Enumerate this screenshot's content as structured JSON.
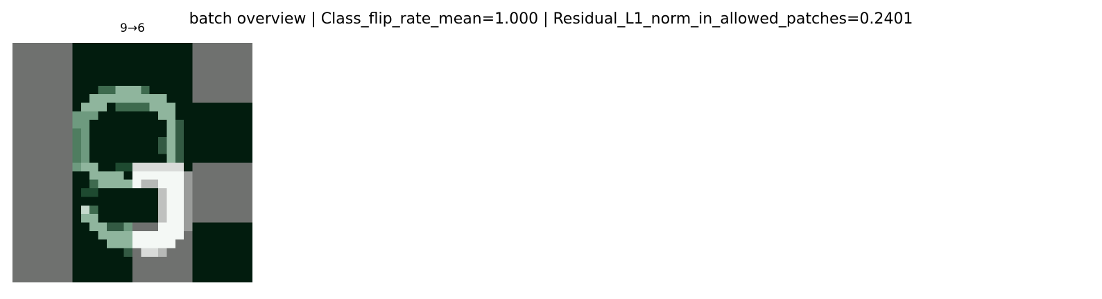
{
  "figure": {
    "title": "batch overview | Class_flip_rate_mean=1.000 | Residual_L1_norm_in_allowed_patches=0.2401"
  },
  "panels": [
    {
      "label": "9→6"
    }
  ],
  "colors": {
    "background": "#ffffff",
    "masked_patch_gray": "#6f716f",
    "allowed_patch_dark": "#021c0e",
    "digit_stroke_green": "#8fb59d",
    "perturbation_white": "#f4f8f5"
  }
}
